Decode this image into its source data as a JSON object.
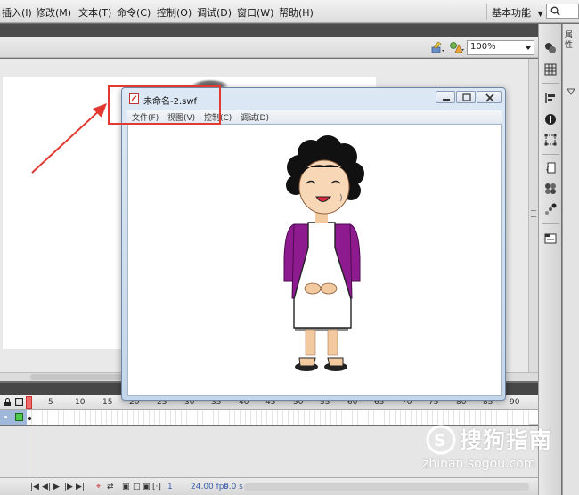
{
  "menubar": {
    "items": [
      "插入(I)",
      "修改(M)",
      "文本(T)",
      "命令(C)",
      "控制(O)",
      "调试(D)",
      "窗口(W)",
      "帮助(H)"
    ],
    "workspace_label": "基本功能"
  },
  "editbar": {
    "zoom_value": "100%"
  },
  "swf_window": {
    "title": "未命名-2.swf",
    "menu": [
      "文件(F)",
      "视图(V)",
      "控制(C)",
      "调试(D)"
    ]
  },
  "timeline": {
    "ticks": [
      "1",
      "5",
      "10",
      "15",
      "20",
      "25",
      "30",
      "35",
      "40",
      "45",
      "50",
      "55",
      "60",
      "65",
      "70",
      "75",
      "80",
      "85",
      "90"
    ],
    "current_frame": "1",
    "fps": "24.00",
    "fps_unit": "fps",
    "time": "0.0 s"
  },
  "panel": {
    "property_tab": "属性"
  },
  "watermark": {
    "brand": "搜狗指南",
    "url": "zhinan.sogou.com"
  },
  "colors": {
    "annotation_red": "#e23a32",
    "shirt_purple": "#8e1a90",
    "apron_white": "#ffffff",
    "skirt_gray": "#8c8c8c",
    "hair_black": "#111111"
  },
  "icons": {
    "search": "magnifier-icon",
    "swf_file": "swf-file-icon",
    "minimize": "minimize-icon",
    "maximize": "maximize-icon",
    "close": "close-icon"
  }
}
